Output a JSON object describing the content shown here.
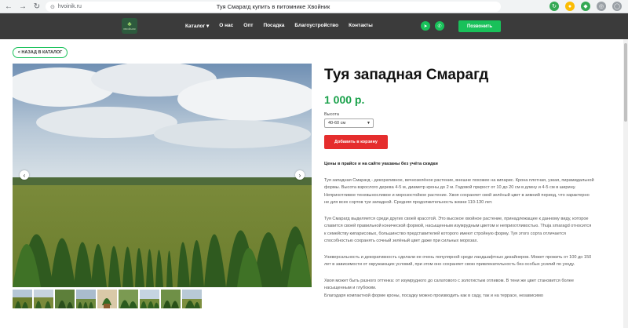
{
  "browser": {
    "url": "hvoinik.ru",
    "page_title": "Туя Смарагд купить в питомнике Хвойник"
  },
  "header": {
    "logo_icon": "tree-logo",
    "logo_text": "ХВОЙНИК",
    "nav": [
      "Каталог",
      "О нас",
      "Опт",
      "Посадка",
      "Благоустройство",
      "Контакты"
    ],
    "call_button": "Позвонить",
    "accent": "#19c15a"
  },
  "back_button": "< НАЗАД В КАТАЛОГ",
  "product": {
    "title": "Туя западная Смарагд",
    "price": "1 000 р.",
    "height_label": "Высота",
    "height_value": "40-60 см",
    "add_to_cart": "Добавить в корзину",
    "price_note": "Цены в прайсе и на сайте указаны без учёта скидки",
    "description": [
      "Туя западная Смарагд - декоративное, вечнозелёное растение, внешне похожее на кипарис. Крона плотная, узкая, пирамидальной формы. Высота взрослого дерева 4-5 м, диаметр кроны до 2 м. Годовой прирост от 10 до 20 см в длину и 4-5 см в ширину. Неприхотливое теневыносливое и морозостойкое растение. Хвоя сохраняет свой зелёный цвет в зимний период, что характерно не для всех сортов туи западной. Средняя продолжительность жизни 110-130 лет.",
      "Туя Смарагд выделяется среди других своей красотой. Это высокое хвойное растение, принадлежащее к данному виду, которое славится своей правильной конической формой, насыщенным изумрудным цветом и неприхотливостью. Thuja smaragd относится к семейству кипарисовых, большинство представителей которого имеют стройную форму. Туя этого сорта отличается способностью сохранять сочный зелёный цвет даже при сильных морозах.",
      "Универсальность и декоративность сделали ее очень популярной среди ландшафтных дизайнеров. Может прожить от 100 до 150 лет в зависимости от окружающих условий, при этом оно сохраняет свою привлекательность без особых усилий по уходу.",
      "Хвоя может быть разного оттенка: от изумрудного до салатового с золотистым отливом. В тени же цвет становится более насыщенным и глубоким.",
      "Благодаря компактной форме кроны, посадку можно производить как в саду, так и на террасе, независимо"
    ]
  }
}
